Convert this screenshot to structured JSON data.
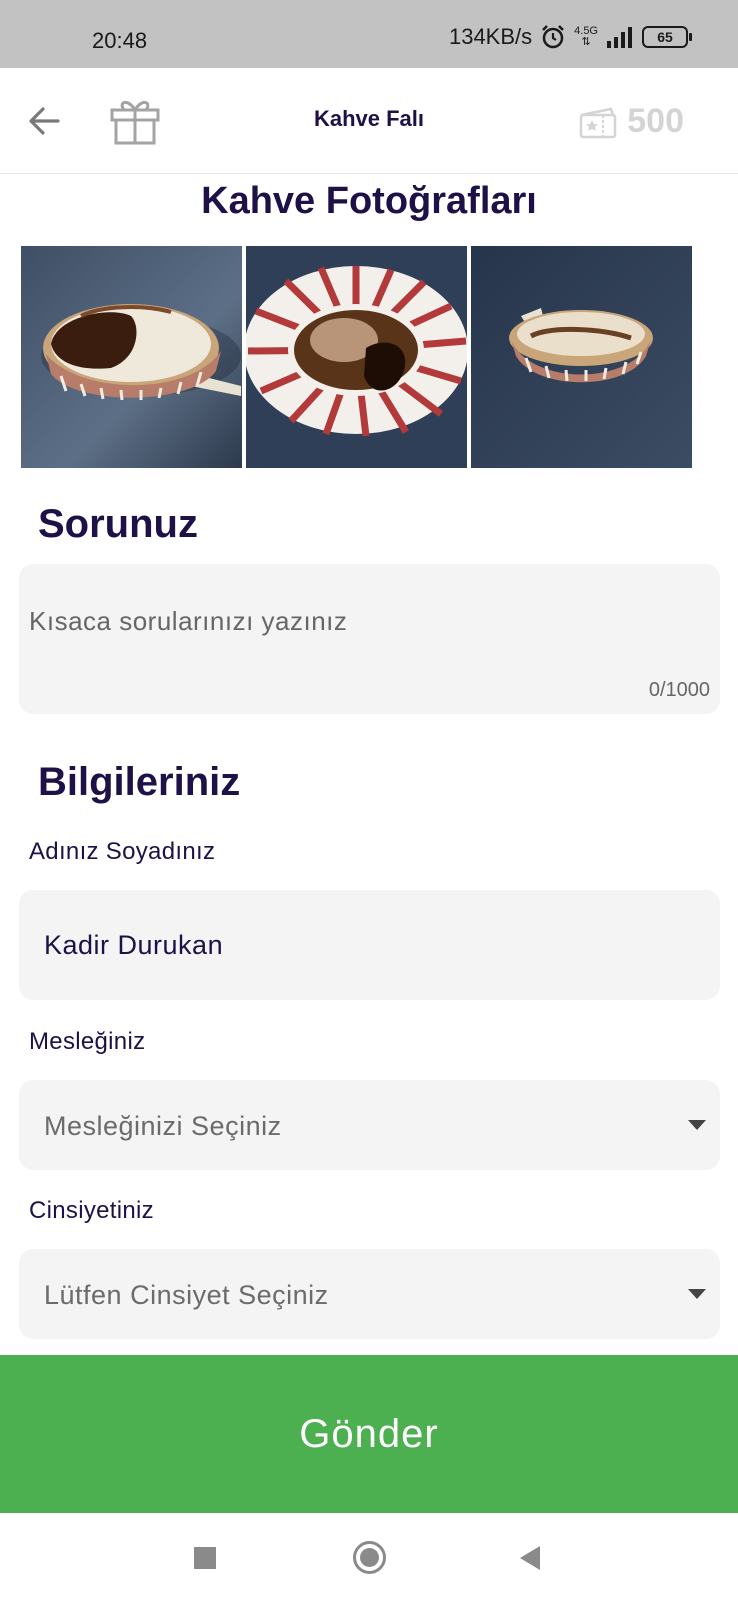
{
  "status_bar": {
    "time": "20:48",
    "speed": "134KB/s",
    "network": "4.5G",
    "battery": "65"
  },
  "app_bar": {
    "title": "Kahve Falı",
    "credits": "500",
    "icons": [
      "back-arrow-icon",
      "gift-icon",
      "ticket-star-icon"
    ]
  },
  "photos": {
    "title": "Kahve Fotoğrafları",
    "items": [
      "coffee-cup-side",
      "coffee-saucer-striped",
      "coffee-cup-striped"
    ]
  },
  "question": {
    "title": "Sorunuz",
    "placeholder": "Kısaca sorularınızı yazınız",
    "counter": "0/1000"
  },
  "info": {
    "title": "Bilgileriniz",
    "name_label": "Adınız Soyadınız",
    "name_value": "Kadir Durukan",
    "job_label": "Mesleğiniz",
    "job_placeholder": "Mesleğinizi Seçiniz",
    "gender_label": "Cinsiyetiniz",
    "gender_placeholder": "Lütfen Cinsiyet Seçiniz"
  },
  "submit_label": "Gönder",
  "colors": {
    "primary_text": "#1f1147",
    "submit_bg": "#4caf50",
    "field_bg": "#f4f4f4"
  }
}
